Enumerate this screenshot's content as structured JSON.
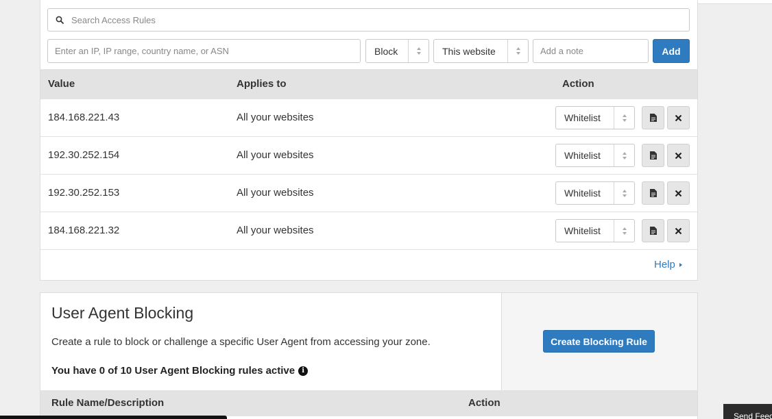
{
  "access_rules": {
    "search_placeholder": "Search Access Rules",
    "ip_placeholder": "Enter an IP, IP range, country name, or ASN",
    "action_select": "Block",
    "scope_select": "This website",
    "note_placeholder": "Add a note",
    "add_label": "Add",
    "columns": [
      "Value",
      "Applies to",
      "Action"
    ],
    "rows": [
      {
        "value": "184.168.221.43",
        "applies_to": "All your websites",
        "action": "Whitelist"
      },
      {
        "value": "192.30.252.154",
        "applies_to": "All your websites",
        "action": "Whitelist"
      },
      {
        "value": "192.30.252.153",
        "applies_to": "All your websites",
        "action": "Whitelist"
      },
      {
        "value": "184.168.221.32",
        "applies_to": "All your websites",
        "action": "Whitelist"
      }
    ],
    "help_label": "Help"
  },
  "user_agent_blocking": {
    "title": "User Agent Blocking",
    "description": "Create a rule to block or challenge a specific User Agent from accessing your zone.",
    "rules_active": "You have 0 of 10 User Agent Blocking rules active",
    "create_button": "Create Blocking Rule",
    "columns": [
      "Rule Name/Description",
      "Action"
    ]
  },
  "feedback": {
    "label": "Send Feedback"
  },
  "colors": {
    "accent": "#2f7bbf",
    "header_bg": "#e3e3e3"
  }
}
